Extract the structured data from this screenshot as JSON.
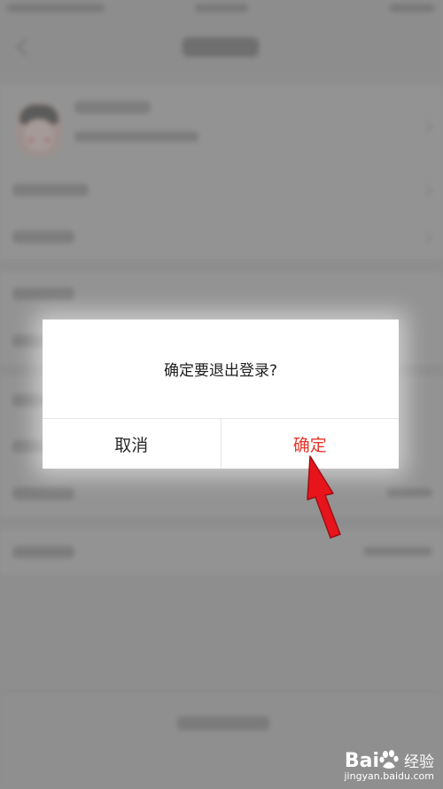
{
  "dialog": {
    "message": "确定要退出登录?",
    "cancel_label": "取消",
    "confirm_label": "确定"
  },
  "watermark": {
    "brand_prefix": "Bai",
    "brand_suffix": "经验",
    "url": "jingyan.baidu.com"
  },
  "colors": {
    "confirm": "#e5352b",
    "overlay": "#8e8e8e",
    "annotation_arrow": "#e8141b"
  }
}
